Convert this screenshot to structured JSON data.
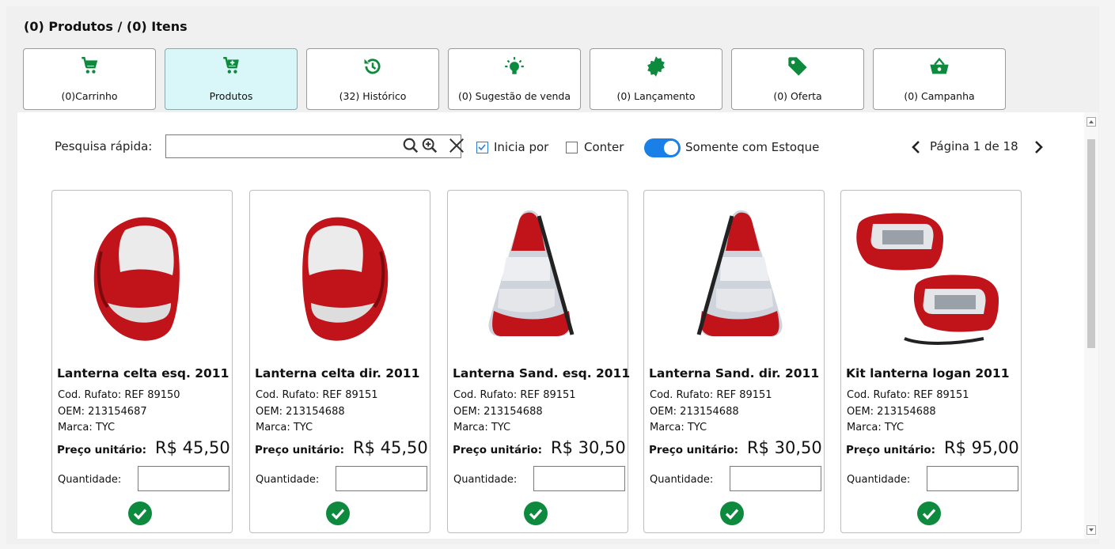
{
  "header": {
    "title": "(0) Produtos / (0) Itens"
  },
  "tabs": [
    {
      "label": "(0)Carrinho",
      "icon": "cart-icon"
    },
    {
      "label": "Produtos",
      "icon": "cart-plus-icon"
    },
    {
      "label": "(32) Histórico",
      "icon": "history-icon"
    },
    {
      "label": "(0) Sugestão de venda",
      "icon": "lightbulb-icon"
    },
    {
      "label": "(0) Lançamento",
      "icon": "badge-star-icon"
    },
    {
      "label": "(0) Oferta",
      "icon": "tag-icon"
    },
    {
      "label": "(0) Campanha",
      "icon": "basket-icon"
    }
  ],
  "colors": {
    "accent_green": "#0e8a3e",
    "toggle_blue": "#1a7fe6",
    "active_tab": "#d9f6f8"
  },
  "search": {
    "label": "Pesquisa rápida:",
    "value": "",
    "inicia_por": "Inicia por",
    "conter": "Conter",
    "somente_estoque": "Somente com Estoque"
  },
  "pager": {
    "text": "Página 1 de 18"
  },
  "products": [
    {
      "title": "Lanterna celta esq. 2011",
      "cod": "Cod. Rufato: REF 89150",
      "oem": "OEM: 213154687",
      "marca": "Marca: TYC",
      "price_label": "Preço unitário:",
      "price": "R$ 45,50",
      "qty_label": "Quantidade:",
      "image": "tail-light-left-icon"
    },
    {
      "title": "Lanterna celta dir. 2011",
      "cod": "Cod. Rufato: REF 89151",
      "oem": "OEM: 213154688",
      "marca": "Marca: TYC",
      "price_label": "Preço unitário:",
      "price": "R$ 45,50",
      "qty_label": "Quantidade:",
      "image": "tail-light-right-icon"
    },
    {
      "title": "Lanterna Sand. esq. 2011",
      "cod": "Cod. Rufato: REF 89151",
      "oem": "OEM: 213154688",
      "marca": "Marca: TYC",
      "price_label": "Preço unitário:",
      "price": "R$ 30,50",
      "qty_label": "Quantidade:",
      "image": "tail-light-icon"
    },
    {
      "title": "Lanterna Sand. dir. 2011",
      "cod": "Cod. Rufato: REF 89151",
      "oem": "OEM: 213154688",
      "marca": "Marca: TYC",
      "price_label": "Preço unitário:",
      "price": "R$ 30,50",
      "qty_label": "Quantidade:",
      "image": "tail-light-icon"
    },
    {
      "title": "Kit lanterna logan 2011",
      "cod": "Cod. Rufato: REF 89151",
      "oem": "OEM: 213154688",
      "marca": "Marca: TYC",
      "price_label": "Preço unitário:",
      "price": "R$ 95,00",
      "qty_label": "Quantidade:",
      "image": "tail-light-kit-icon"
    }
  ]
}
